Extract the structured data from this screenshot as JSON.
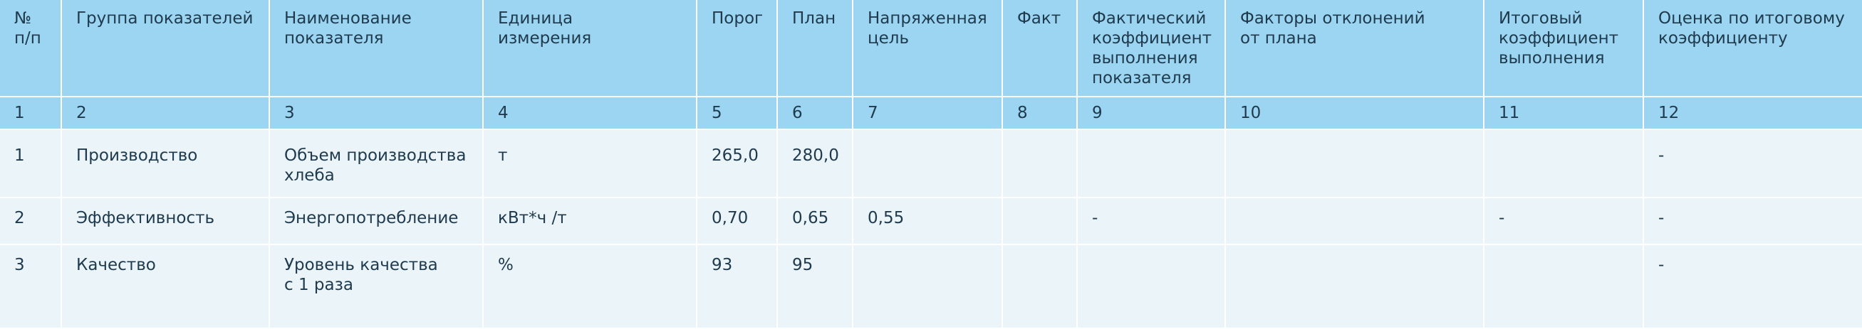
{
  "headers": [
    "№\nп/п",
    "Группа показателей",
    "Наименование\nпоказателя",
    "Единица\nизмерения",
    "Порог",
    "План",
    "Напряженная\nцель",
    "Факт",
    "Фактический\nкоэффициент\nвыполнения\nпоказателя",
    "Факторы отклонений\nот плана",
    "Итоговый\nкоэффициент\nвыполнения",
    "Оценка по итоговому\nкоэффициенту"
  ],
  "column_numbers": [
    "1",
    "2",
    "3",
    "4",
    "5",
    "6",
    "7",
    "8",
    "9",
    "10",
    "11",
    "12"
  ],
  "rows": [
    [
      "1",
      "Производство",
      "Объем производства\nхлеба",
      "т",
      "265,0",
      "280,0",
      "",
      "",
      "",
      "",
      "",
      "-"
    ],
    [
      "2",
      "Эффективность",
      "Энергопотребление",
      "кВт*ч /т",
      "0,70",
      "0,65",
      "0,55",
      "",
      "-",
      "",
      "-",
      "-"
    ],
    [
      "3",
      "Качество",
      "Уровень качества\nс 1 раза",
      "%",
      "93",
      "95",
      "",
      "",
      "",
      "",
      "",
      "-"
    ]
  ],
  "colors": {
    "header_bg": "#9bd5f1",
    "body_bg": "#eaf4f9",
    "text": "#1f3a4d",
    "grid": "#ffffff"
  }
}
